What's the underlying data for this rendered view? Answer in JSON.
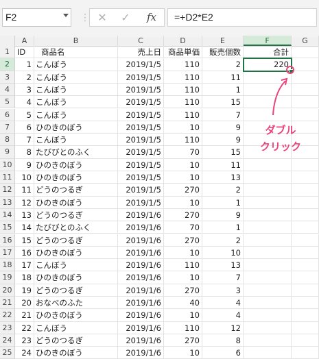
{
  "formula_bar": {
    "name_box": "F2",
    "separator": "⋮",
    "cancel_icon": "✕",
    "enter_icon": "✓",
    "fx_label": "fx",
    "formula": "=+D2*E2"
  },
  "columns": [
    "A",
    "B",
    "C",
    "D",
    "E",
    "F",
    "G"
  ],
  "header_row": {
    "a": "ID",
    "b": "商品名",
    "c": "売上日",
    "d": "商品単価",
    "e": "販売個数",
    "f": "合計"
  },
  "rows": [
    {
      "num": "2",
      "a": "1",
      "b": "こんぼう",
      "c": "2019/1/5",
      "d": "110",
      "e": "2",
      "f": "220"
    },
    {
      "num": "3",
      "a": "2",
      "b": "こんぼう",
      "c": "2019/1/5",
      "d": "110",
      "e": "11",
      "f": ""
    },
    {
      "num": "4",
      "a": "3",
      "b": "こんぼう",
      "c": "2019/1/5",
      "d": "110",
      "e": "1",
      "f": ""
    },
    {
      "num": "5",
      "a": "4",
      "b": "こんぼう",
      "c": "2019/1/5",
      "d": "110",
      "e": "15",
      "f": ""
    },
    {
      "num": "6",
      "a": "5",
      "b": "こんぼう",
      "c": "2019/1/5",
      "d": "110",
      "e": "7",
      "f": ""
    },
    {
      "num": "7",
      "a": "6",
      "b": "ひのきのぼう",
      "c": "2019/1/5",
      "d": "10",
      "e": "9",
      "f": ""
    },
    {
      "num": "8",
      "a": "7",
      "b": "こんぼう",
      "c": "2019/1/5",
      "d": "110",
      "e": "9",
      "f": ""
    },
    {
      "num": "9",
      "a": "8",
      "b": "たびびとのふく",
      "c": "2019/1/5",
      "d": "70",
      "e": "15",
      "f": ""
    },
    {
      "num": "10",
      "a": "9",
      "b": "ひのきのぼう",
      "c": "2019/1/5",
      "d": "10",
      "e": "11",
      "f": ""
    },
    {
      "num": "11",
      "a": "10",
      "b": "ひのきのぼう",
      "c": "2019/1/5",
      "d": "10",
      "e": "13",
      "f": ""
    },
    {
      "num": "12",
      "a": "11",
      "b": "どうのつるぎ",
      "c": "2019/1/5",
      "d": "270",
      "e": "2",
      "f": ""
    },
    {
      "num": "13",
      "a": "12",
      "b": "ひのきのぼう",
      "c": "2019/1/5",
      "d": "10",
      "e": "1",
      "f": ""
    },
    {
      "num": "14",
      "a": "13",
      "b": "どうのつるぎ",
      "c": "2019/1/6",
      "d": "270",
      "e": "9",
      "f": ""
    },
    {
      "num": "15",
      "a": "14",
      "b": "たびびとのふく",
      "c": "2019/1/6",
      "d": "70",
      "e": "1",
      "f": ""
    },
    {
      "num": "16",
      "a": "15",
      "b": "どうのつるぎ",
      "c": "2019/1/6",
      "d": "270",
      "e": "2",
      "f": ""
    },
    {
      "num": "17",
      "a": "16",
      "b": "ひのきのぼう",
      "c": "2019/1/6",
      "d": "10",
      "e": "10",
      "f": ""
    },
    {
      "num": "18",
      "a": "17",
      "b": "こんぼう",
      "c": "2019/1/6",
      "d": "110",
      "e": "13",
      "f": ""
    },
    {
      "num": "19",
      "a": "18",
      "b": "ひのきのぼう",
      "c": "2019/1/6",
      "d": "10",
      "e": "7",
      "f": ""
    },
    {
      "num": "20",
      "a": "19",
      "b": "どうのつるぎ",
      "c": "2019/1/6",
      "d": "270",
      "e": "3",
      "f": ""
    },
    {
      "num": "21",
      "a": "20",
      "b": "おなべのふた",
      "c": "2019/1/6",
      "d": "40",
      "e": "4",
      "f": ""
    },
    {
      "num": "22",
      "a": "21",
      "b": "ひのきのぼう",
      "c": "2019/1/6",
      "d": "10",
      "e": "4",
      "f": ""
    },
    {
      "num": "23",
      "a": "22",
      "b": "こんぼう",
      "c": "2019/1/6",
      "d": "110",
      "e": "12",
      "f": ""
    },
    {
      "num": "24",
      "a": "23",
      "b": "どうのつるぎ",
      "c": "2019/1/6",
      "d": "270",
      "e": "8",
      "f": ""
    },
    {
      "num": "25",
      "a": "24",
      "b": "ひのきのぼう",
      "c": "2019/1/6",
      "d": "10",
      "e": "6",
      "f": ""
    }
  ],
  "annotation": {
    "line1": "ダブル",
    "line2": "クリック",
    "color": "#e8457a"
  },
  "colors": {
    "accent": "#217346"
  }
}
